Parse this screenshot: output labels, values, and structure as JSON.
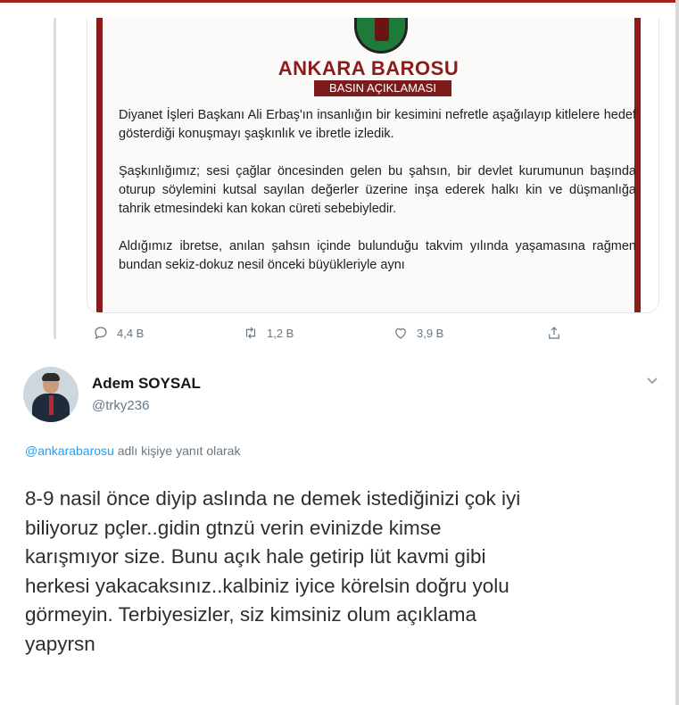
{
  "quoted_tweet": {
    "doc_title": "ANKARA BAROSU",
    "doc_subtitle": "BASIN AÇIKLAMASI",
    "paragraphs": [
      "Diyanet İşleri Başkanı Ali Erbaş'ın insanlığın bir kesimini nefretle aşağılayıp kitlelere hedef gösterdiği konuşmayı şaşkınlık ve ibretle izledik.",
      "Şaşkınlığımız; sesi çağlar öncesinden gelen bu şahsın, bir devlet kurumunun başında oturup söylemini kutsal sayılan değerler üzerine inşa ederek halkı kin ve düşmanlığa tahrik etmesindeki kan kokan cüreti sebebiyledir.",
      "Aldığımız ibretse, anılan şahsın içinde bulunduğu takvim yılında yaşamasına rağmen bundan sekiz-dokuz nesil önceki büyükleriyle aynı"
    ]
  },
  "actions": {
    "reply_count": "4,4 B",
    "retweet_count": "1,2 B",
    "like_count": "3,9 B"
  },
  "reply": {
    "user_name": "Adem SOYSAL",
    "user_handle": "@trky236",
    "mention": "@ankarabarosu",
    "reply_suffix": " adlı kişiye yanıt olarak",
    "text": "8-9 nasil önce diyip aslında ne demek istediğinizi çok iyi\nbiliyoruz pçler..gidin gtnzü verin evinizde kimse\nkarışmıyor size. Bunu açık hale getirip lüt kavmi gibi\nherkesi yakacaksınız..kalbiniz iyice körelsin doğru yolu\ngörmeyin. Terbiyesizler, siz kimsiniz olum açıklama\nyapyrsn"
  },
  "colors": {
    "accent": "#1da1f2",
    "bar_red": "#8c1b1b",
    "muted": "#657786"
  }
}
